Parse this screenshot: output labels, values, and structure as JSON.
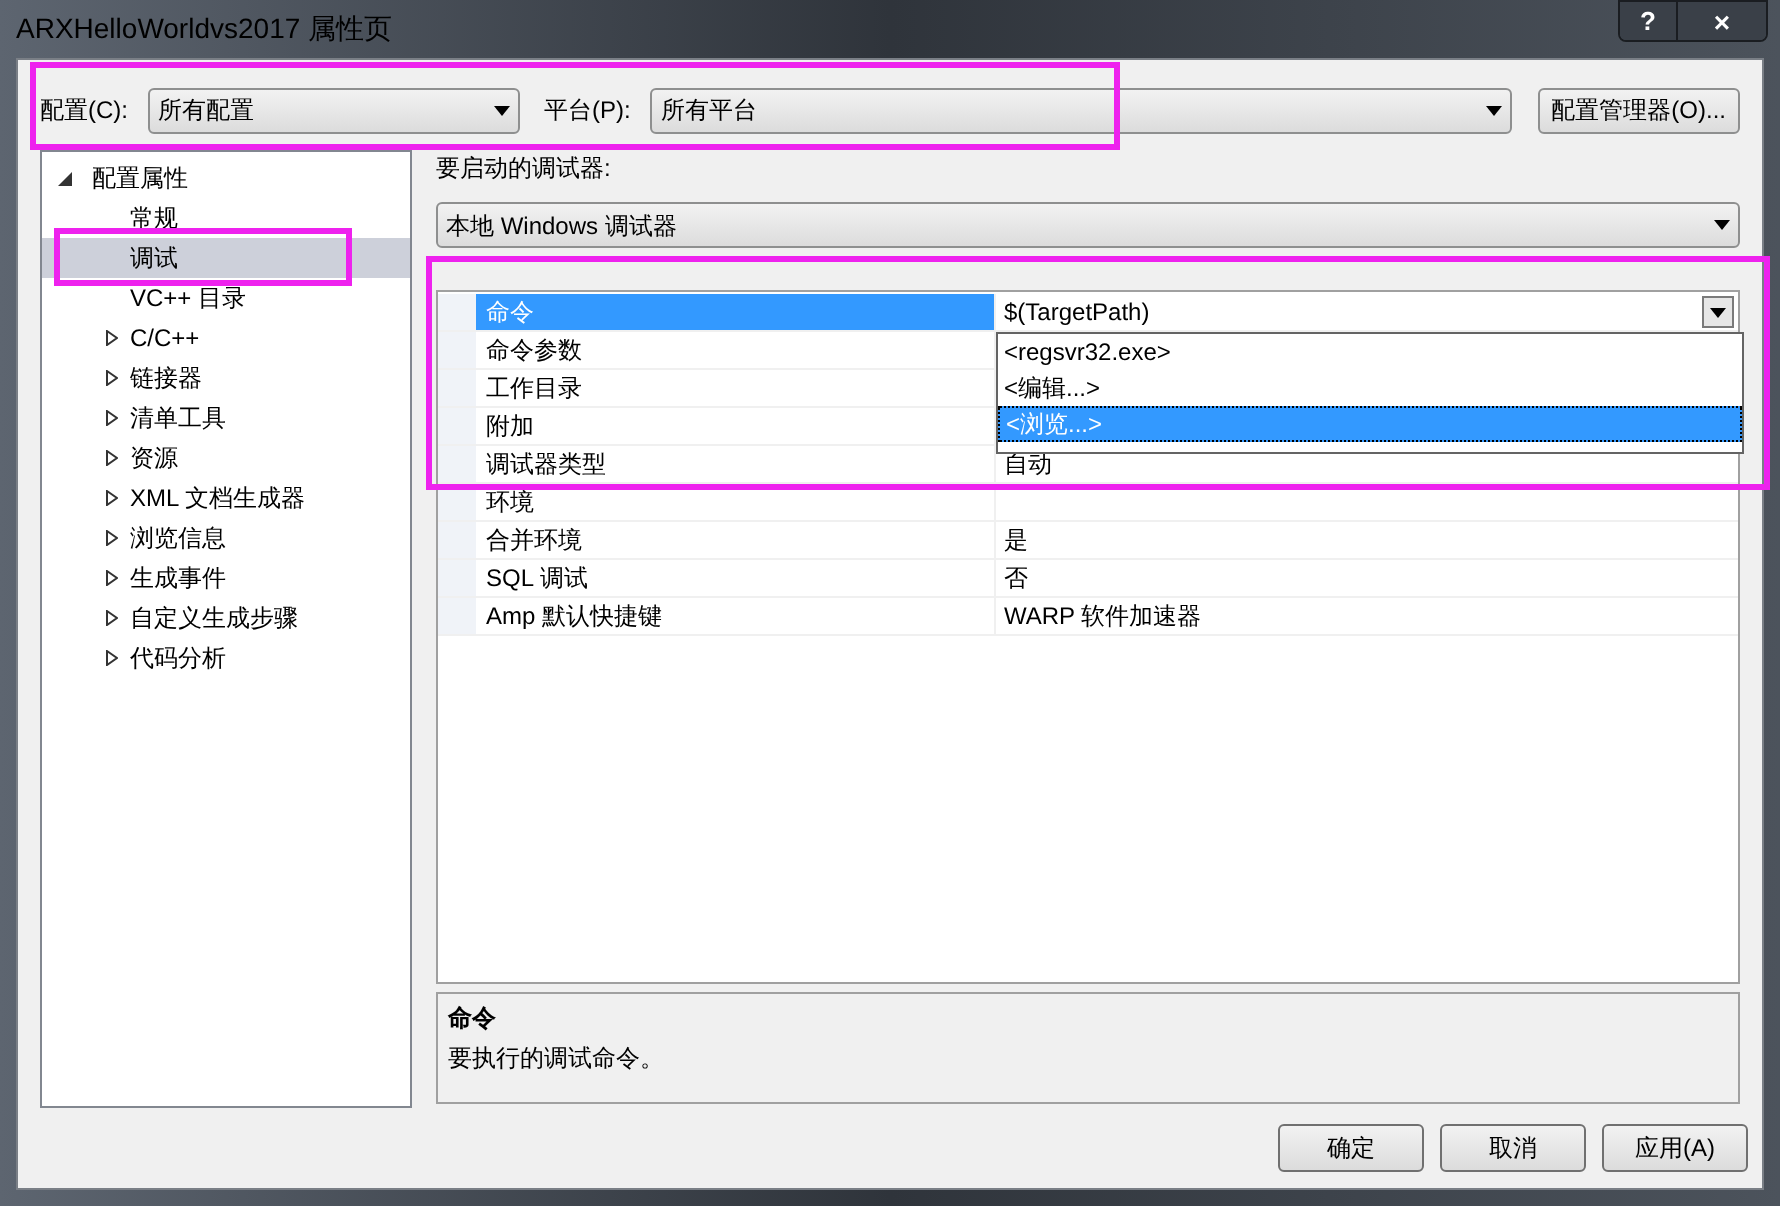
{
  "window": {
    "title": "ARXHelloWorldvs2017 属性页",
    "buttons": [
      "?",
      "×"
    ]
  },
  "config_bar": {
    "highlighted": true,
    "config_label": "配置(C):",
    "config_value": "所有配置",
    "platform_label": "平台(P):",
    "platform_value": "所有平台",
    "manager_button": "配置管理器(O)..."
  },
  "tree": {
    "items": [
      {
        "label": "配置属性",
        "expanded": true,
        "selected": false,
        "highlighted": false,
        "children": [
          {
            "label": "常规",
            "selected": false,
            "highlighted": false
          },
          {
            "label": "调试",
            "selected": true,
            "highlighted": true
          },
          {
            "label": "VC++ 目录",
            "selected": false,
            "highlighted": false
          },
          {
            "label": "C/C++",
            "expanded": false,
            "selected": false,
            "highlighted": false
          },
          {
            "label": "链接器",
            "expanded": false,
            "selected": false,
            "highlighted": false
          },
          {
            "label": "清单工具",
            "expanded": false,
            "selected": false,
            "highlighted": false
          },
          {
            "label": "资源",
            "expanded": false,
            "selected": false,
            "highlighted": false
          },
          {
            "label": "XML 文档生成器",
            "expanded": false,
            "selected": false,
            "highlighted": false
          },
          {
            "label": "浏览信息",
            "expanded": false,
            "selected": false,
            "highlighted": false
          },
          {
            "label": "生成事件",
            "expanded": false,
            "selected": false,
            "highlighted": false
          },
          {
            "label": "自定义生成步骤",
            "expanded": false,
            "selected": false,
            "highlighted": false
          },
          {
            "label": "代码分析",
            "expanded": false,
            "selected": false,
            "highlighted": false
          }
        ]
      }
    ]
  },
  "debugger": {
    "label": "要启动的调试器:",
    "value": "本地 Windows 调试器"
  },
  "grid": {
    "highlighted": true,
    "rows": [
      {
        "name": "命令",
        "value": "$(TargetPath)",
        "selected": true
      },
      {
        "name": "命令参数",
        "selected": false
      },
      {
        "name": "工作目录",
        "selected": false
      },
      {
        "name": "附加",
        "selected": false
      },
      {
        "name": "调试器类型",
        "value": "自动",
        "selected": false
      },
      {
        "name": "环境",
        "selected": false
      },
      {
        "name": "合并环境",
        "value": "是",
        "selected": false
      },
      {
        "name": "SQL 调试",
        "value": "否",
        "selected": false
      },
      {
        "name": "Amp 默认快捷键",
        "value": "WARP 软件加速器",
        "selected": false
      }
    ],
    "dropdown": {
      "options": [
        {
          "label": "<regsvr32.exe>",
          "selected": false
        },
        {
          "label": "<编辑...>",
          "selected": false
        },
        {
          "label": "<浏览...>",
          "selected": true
        }
      ]
    }
  },
  "description": {
    "title": "命令",
    "text": "要执行的调试命令。"
  },
  "buttons": [
    "确定",
    "取消",
    "应用(A)"
  ]
}
